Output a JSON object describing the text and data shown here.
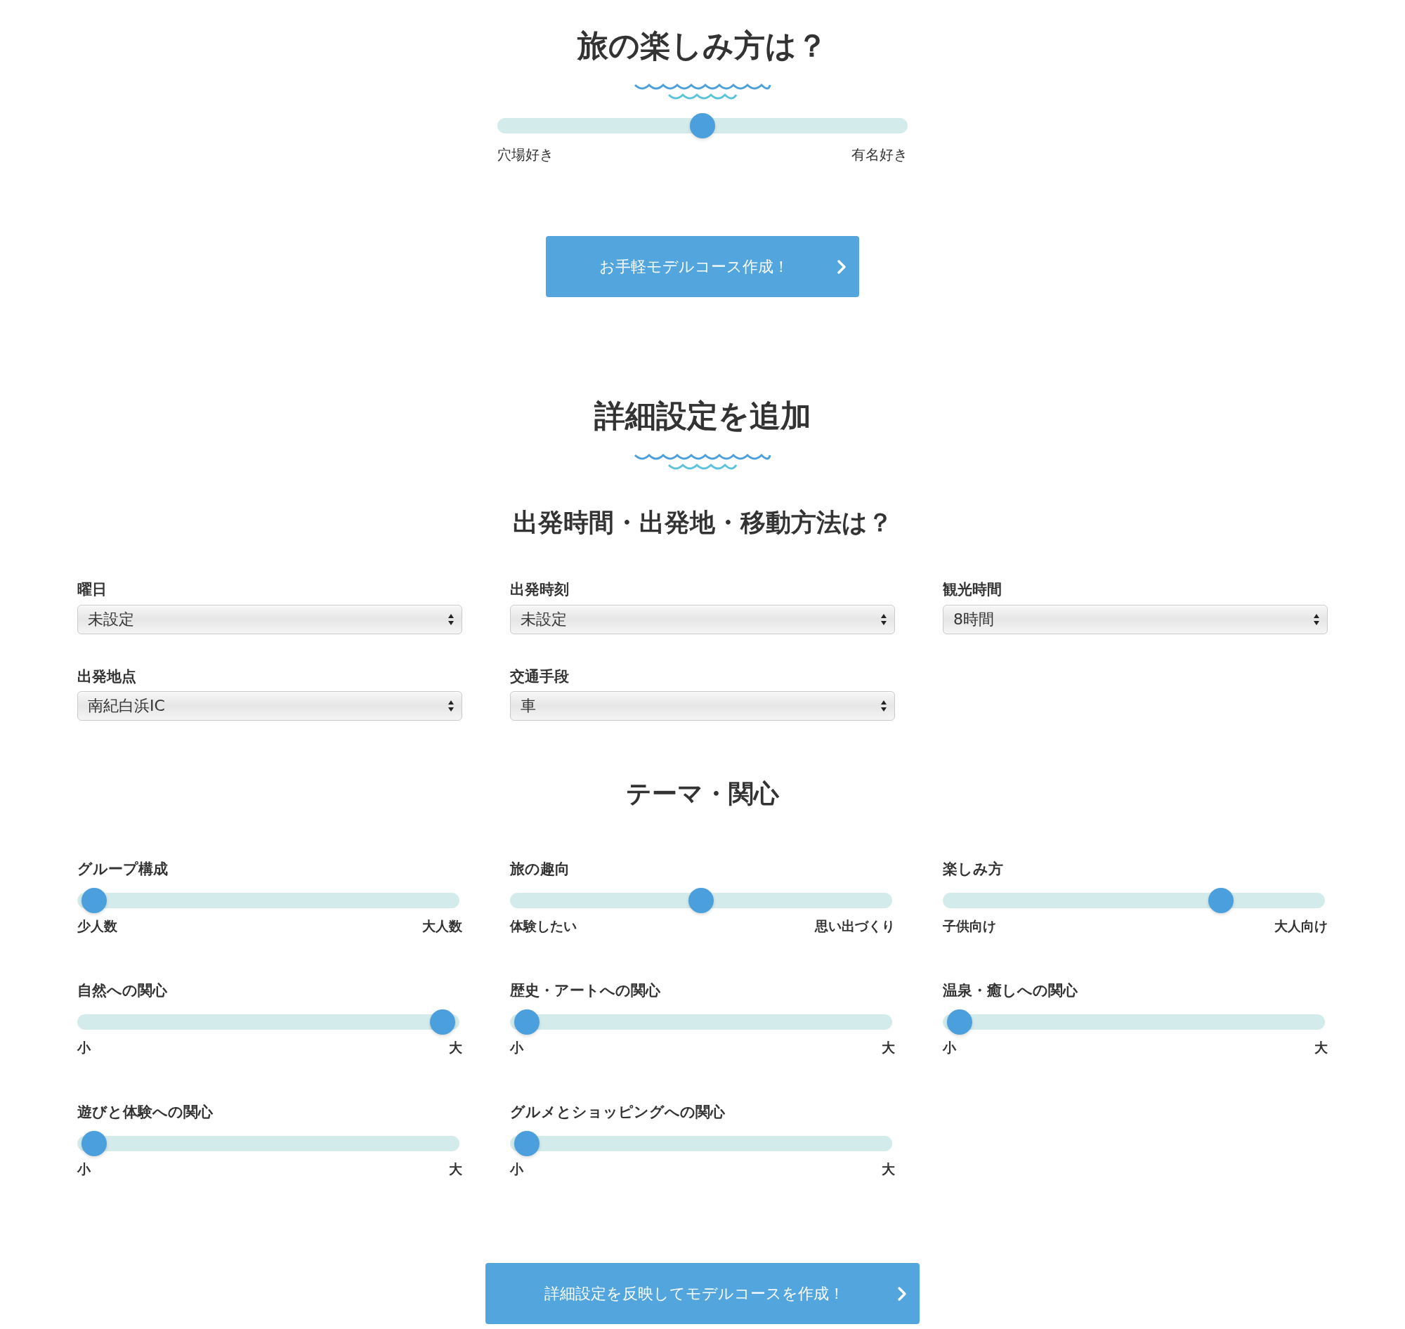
{
  "intro": {
    "title": "旅の楽しみ方は？",
    "slider": {
      "level": 0.5,
      "min_label": "穴場好き",
      "max_label": "有名好き"
    },
    "button": {
      "label": "お手軽モデルコース作成！"
    }
  },
  "details": {
    "title": "詳細設定を追加",
    "departure": {
      "heading": "出発時間・出発地・移動方法は？",
      "fields": [
        {
          "label": "曜日",
          "value": "未設定"
        },
        {
          "label": "出発時刻",
          "value": "未設定"
        },
        {
          "label": "観光時間",
          "value": "8時間"
        },
        {
          "label": "出発地点",
          "value": "南紀白浜IC"
        },
        {
          "label": "交通手段",
          "value": "車"
        }
      ]
    },
    "themes": {
      "heading": "テーマ・関心",
      "sliders": [
        {
          "label": "グループ構成",
          "level": 0,
          "min_label": "少人数",
          "max_label": "大人数"
        },
        {
          "label": "旅の趣向",
          "level": 0.5,
          "min_label": "体験したい",
          "max_label": "思い出づくり"
        },
        {
          "label": "楽しみ方",
          "level": 0.75,
          "min_label": "子供向け",
          "max_label": "大人向け"
        },
        {
          "label": "自然への関心",
          "level": 1,
          "min_label": "小",
          "max_label": "大"
        },
        {
          "label": "歴史・アートへの関心",
          "level": 0,
          "min_label": "小",
          "max_label": "大"
        },
        {
          "label": "温泉・癒しへの関心",
          "level": 0,
          "min_label": "小",
          "max_label": "大"
        },
        {
          "label": "遊びと体験への関心",
          "level": 0,
          "min_label": "小",
          "max_label": "大"
        },
        {
          "label": "グルメとショッピングへの関心",
          "level": 0,
          "min_label": "小",
          "max_label": "大"
        }
      ]
    },
    "button": {
      "label": "詳細設定を反映してモデルコースを作成！"
    }
  }
}
